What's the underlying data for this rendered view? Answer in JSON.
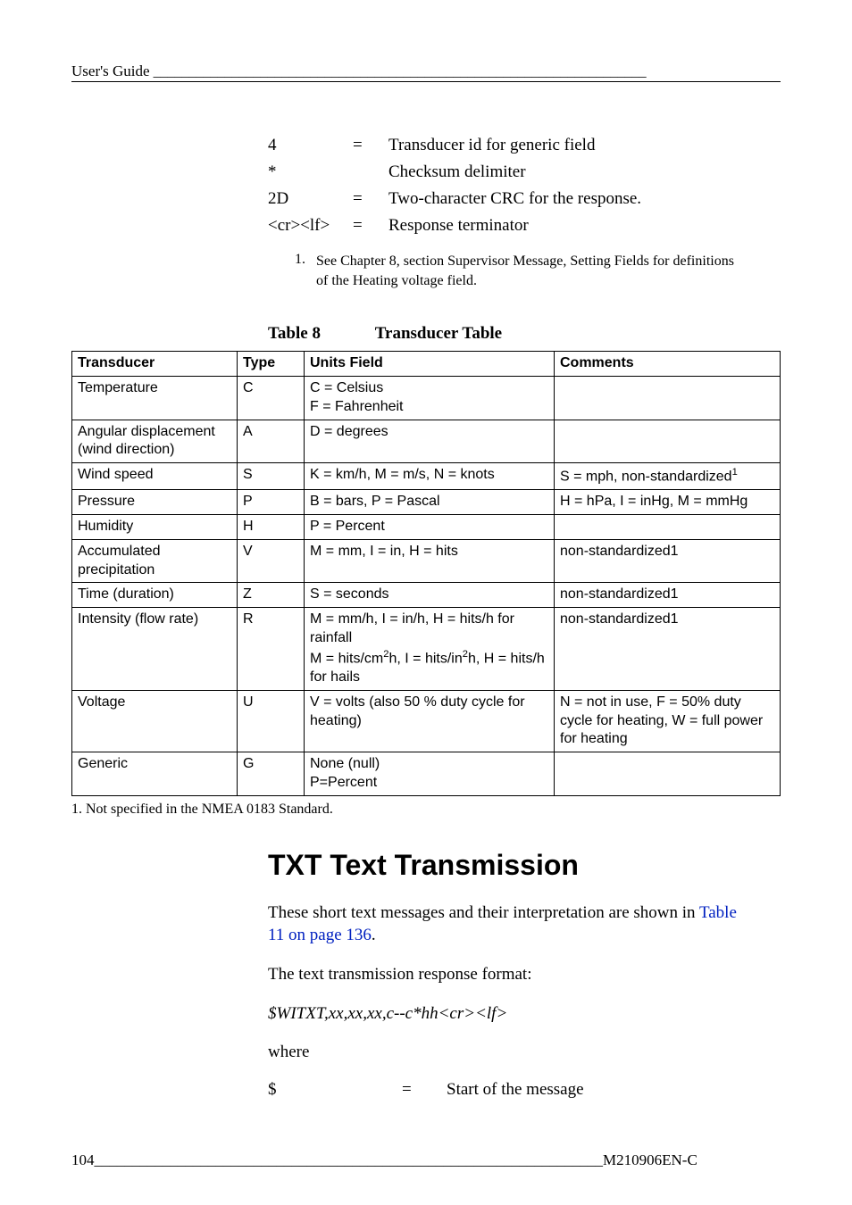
{
  "header": "User's Guide",
  "defs": [
    {
      "term": "4",
      "eq": "=",
      "desc": "Transducer id for generic field"
    },
    {
      "term": "*",
      "eq": "",
      "desc": "Checksum delimiter"
    },
    {
      "term": "2D",
      "eq": "=",
      "desc": "Two-character CRC for the response."
    },
    {
      "term": "<cr><lf>",
      "eq": "=",
      "desc": "Response terminator"
    }
  ],
  "note1_num": "1.",
  "note1_text": "See Chapter 8, section Supervisor Message, Setting Fields for definitions of the Heating voltage field.",
  "table_caption_label": "Table 8",
  "table_caption_text": "Transducer Table",
  "thead": [
    "Transducer",
    "Type",
    "Units Field",
    "Comments"
  ],
  "rows": {
    "temperature": {
      "c0": "Temperature",
      "c1": "C",
      "c2_a": "C = Celsius",
      "c2_b": "F = Fahrenheit",
      "c3": ""
    },
    "angular": {
      "c0_a": "Angular displacement",
      "c0_b": "(wind direction)",
      "c1": "A",
      "c2": "D = degrees",
      "c3": ""
    },
    "wind": {
      "c0": "Wind speed",
      "c1": "S",
      "c2": "K = km/h, M = m/s, N = knots",
      "c3_pre": "S = mph, non-standardized",
      "c3_sup": "1"
    },
    "pressure": {
      "c0": "Pressure",
      "c1": "P",
      "c2": "B = bars, P = Pascal",
      "c3": "H = hPa, I = inHg, M = mmHg"
    },
    "humidity": {
      "c0": "Humidity",
      "c1": "H",
      "c2": "P = Percent",
      "c3": ""
    },
    "accum": {
      "c0_a": "Accumulated",
      "c0_b": "precipitation",
      "c1": "V",
      "c2": "M = mm, I = in, H = hits",
      "c3": "non-standardized1"
    },
    "time": {
      "c0": "Time (duration)",
      "c1": "Z",
      "c2": "S = seconds",
      "c3": "non-standardized1"
    },
    "intensity": {
      "c0": "Intensity (flow rate)",
      "c1": "R",
      "c2_a": "M = mm/h, I = in/h, H = hits/h for rainfall",
      "c2_b_pre": "M = hits/cm",
      "c2_b_sup1": "2",
      "c2_b_mid": "h, I = hits/in",
      "c2_b_sup2": "2",
      "c2_b_post": "h, H = hits/h for hails",
      "c3": "non-standardized1"
    },
    "voltage": {
      "c0": "Voltage",
      "c1": "U",
      "c2": "V = volts (also 50 % duty cycle for heating)",
      "c3": "N = not in use, F = 50% duty cycle for heating, W = full power for heating"
    },
    "generic": {
      "c0": "Generic",
      "c1": "G",
      "c2_a": "None (null)",
      "c2_b": "P=Percent",
      "c3": ""
    }
  },
  "after_table_note": "1.  Not specified in the NMEA 0183 Standard.",
  "section_title": "TXT Text Transmission",
  "para1_pre": "These short text messages and their interpretation are shown in ",
  "para1_link": "Table 11 on page 136",
  "para1_post": ".",
  "para2": "The text transmission response format:",
  "para3": "$WITXT,xx,xx,xx,c--c*hh<cr><lf>",
  "para4": "where",
  "def2": {
    "term": "$",
    "eq": "=",
    "desc": "Start of the message"
  },
  "footer_page": "104",
  "footer_doc": "M210906EN-C"
}
